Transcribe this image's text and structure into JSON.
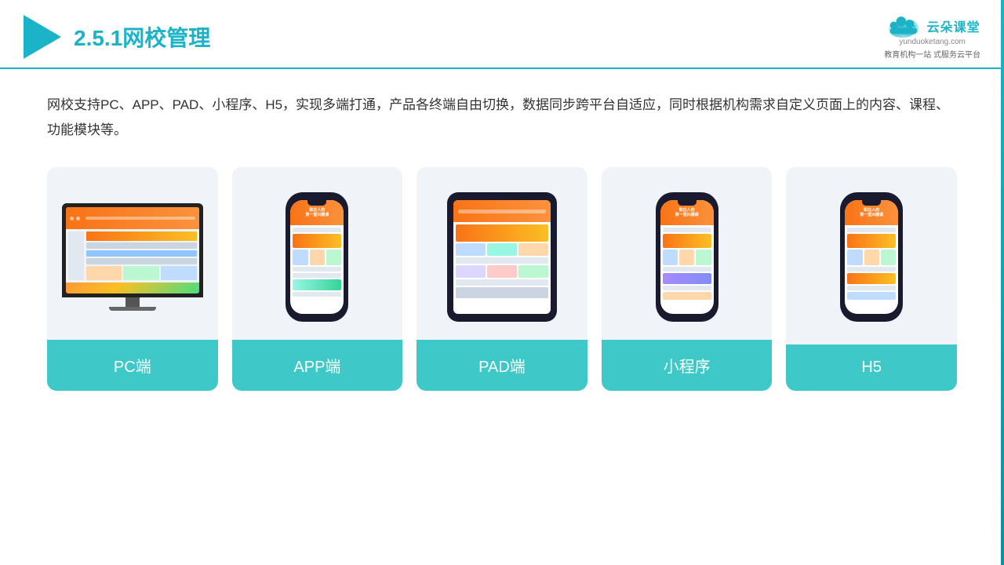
{
  "header": {
    "section_number": "2.5.1",
    "title_plain": "网校管理",
    "brand_name": "云朵课堂",
    "brand_url": "yunduoketang.com",
    "brand_tagline": "教育机构一站\n式服务云平台"
  },
  "description": "网校支持PC、APP、PAD、小程序、H5，实现多端打通，产品各终端自由切换，数据同步跨平台自适应，同时根据机构需求自定义页面上的内容、课程、功能模块等。",
  "cards": [
    {
      "id": "pc",
      "label": "PC端"
    },
    {
      "id": "app",
      "label": "APP端"
    },
    {
      "id": "pad",
      "label": "PAD端"
    },
    {
      "id": "miniprogram",
      "label": "小程序"
    },
    {
      "id": "h5",
      "label": "H5"
    }
  ]
}
